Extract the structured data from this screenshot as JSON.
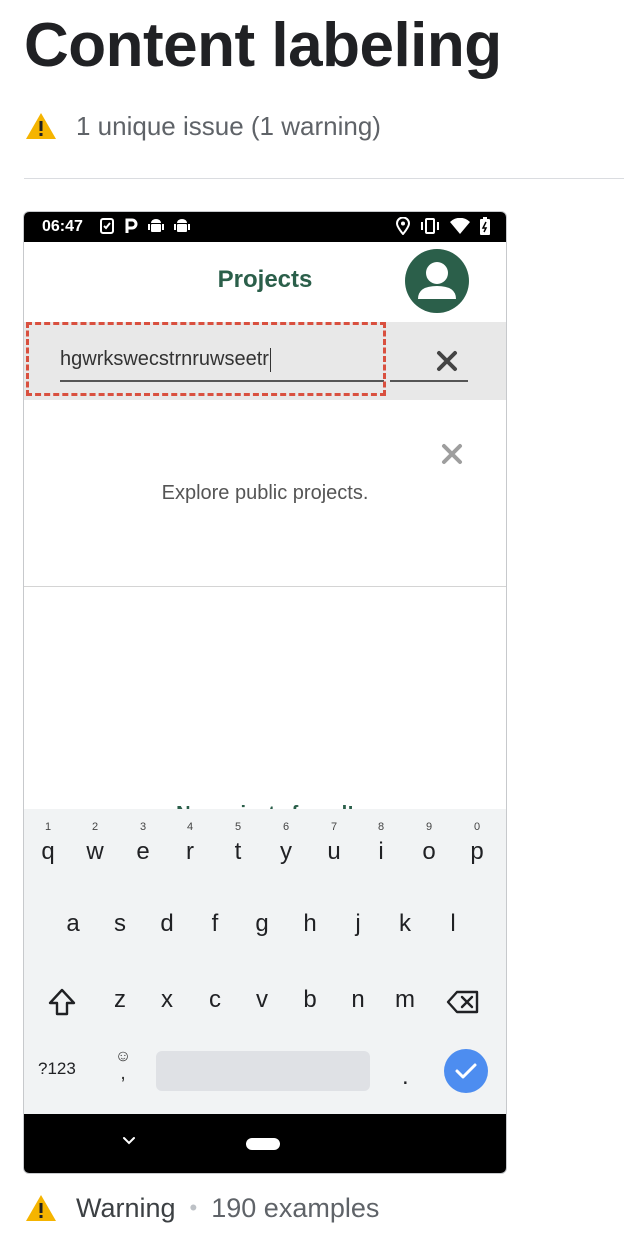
{
  "page": {
    "title": "Content labeling",
    "summary": "1 unique issue (1 warning)"
  },
  "screenshot": {
    "status_bar": {
      "time": "06:47",
      "left_icons": [
        "checklist-icon",
        "parking-icon",
        "android-icon",
        "android-icon"
      ],
      "right_icons": [
        "location-icon",
        "vibrate-icon",
        "wifi-icon",
        "battery-icon"
      ]
    },
    "app_bar": {
      "title": "Projects",
      "avatar_icon": "account-circle-icon"
    },
    "search": {
      "value": "hgwrkswecstrnruwseetr",
      "clear_icon": "close-icon"
    },
    "explore_card": {
      "text": "Explore public projects.",
      "close_icon": "close-icon"
    },
    "empty_state": "No projects found!",
    "keyboard": {
      "row1": [
        {
          "key": "q",
          "hint": "1"
        },
        {
          "key": "w",
          "hint": "2"
        },
        {
          "key": "e",
          "hint": "3"
        },
        {
          "key": "r",
          "hint": "4"
        },
        {
          "key": "t",
          "hint": "5"
        },
        {
          "key": "y",
          "hint": "6"
        },
        {
          "key": "u",
          "hint": "7"
        },
        {
          "key": "i",
          "hint": "8"
        },
        {
          "key": "o",
          "hint": "9"
        },
        {
          "key": "p",
          "hint": "0"
        }
      ],
      "row2": [
        "a",
        "s",
        "d",
        "f",
        "g",
        "h",
        "j",
        "k",
        "l"
      ],
      "row3": [
        "z",
        "x",
        "c",
        "v",
        "b",
        "n",
        "m"
      ],
      "symbols": "?123",
      "emoji": "☺",
      "comma": ",",
      "period": ".",
      "shift_icon": "shift-icon",
      "backspace_icon": "backspace-icon",
      "enter_icon": "check-icon"
    },
    "nav_bar": {
      "back_icon": "chevron-down-icon",
      "home_icon": "home-pill-icon"
    },
    "highlight_color": "#d9503f"
  },
  "footer": {
    "severity": "Warning",
    "separator": "•",
    "examples": "190 examples"
  },
  "colors": {
    "warning": "#f5b400",
    "brand_green": "#2b5f4a",
    "accent_blue": "#4d8df0"
  }
}
